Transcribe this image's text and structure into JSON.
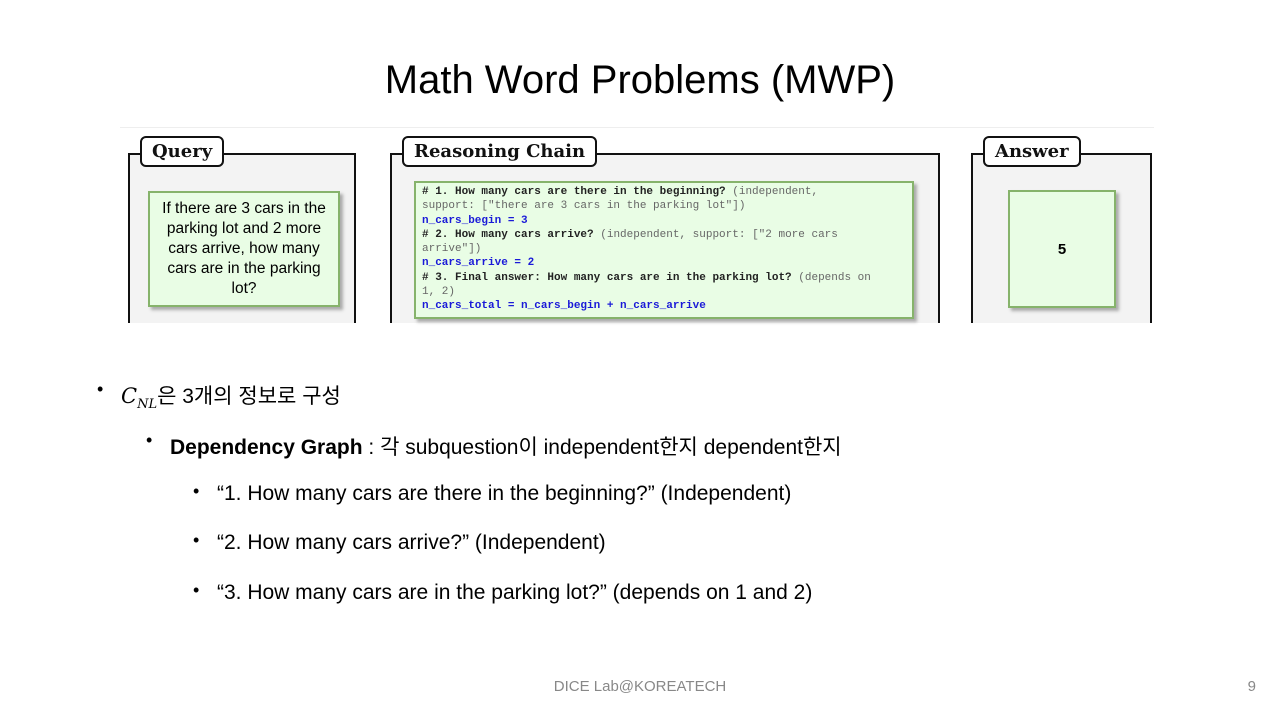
{
  "title": "Math Word Problems (MWP)",
  "figure": {
    "query_label": "Query",
    "query_text": "If there are 3 cars in the parking lot and 2 more cars arrive, how many cars are in the parking lot?",
    "chain_label": "Reasoning Chain",
    "chain_lines": [
      [
        {
          "t": "# 1. How many cars are there in the beginning?",
          "s": "b"
        },
        {
          "t": " (independent,",
          "s": "g"
        }
      ],
      [
        {
          "t": "support: [\"there are 3 cars in the parking lot\"])",
          "s": "g"
        }
      ],
      [
        {
          "t": "n_cars_begin = 3",
          "s": "c"
        }
      ],
      [
        {
          "t": "# 2. How many cars arrive?",
          "s": "b"
        },
        {
          "t": " (independent, support: [\"2 more cars",
          "s": "g"
        }
      ],
      [
        {
          "t": "arrive\"])",
          "s": "g"
        }
      ],
      [
        {
          "t": "n_cars_arrive = 2",
          "s": "c"
        }
      ],
      [
        {
          "t": "# 3. Final answer: How many cars are in the parking lot?",
          "s": "b"
        },
        {
          "t": " (depends on",
          "s": "g"
        }
      ],
      [
        {
          "t": "1, 2)",
          "s": "g"
        }
      ],
      [
        {
          "t": "n_cars_total = n_cars_begin + n_cars_arrive",
          "s": "c"
        }
      ]
    ],
    "answer_label": "Answer",
    "answer_value": "5"
  },
  "bullets": {
    "b1_math": "C",
    "b1_sub": "NL",
    "b1_text": "은 3개의 정보로 구성",
    "b2_bold": "Dependency Graph",
    "b2_text": " : 각 subquestion이 independent한지 dependent한지",
    "b3": [
      "“1. How many cars are there in the beginning?” (Independent)",
      "“2. How many cars arrive?” (Independent)",
      "“3. How many cars are in the parking lot?” (depends on 1 and 2)"
    ]
  },
  "footer": "DICE  Lab@KOREATECH",
  "page_number": "9"
}
